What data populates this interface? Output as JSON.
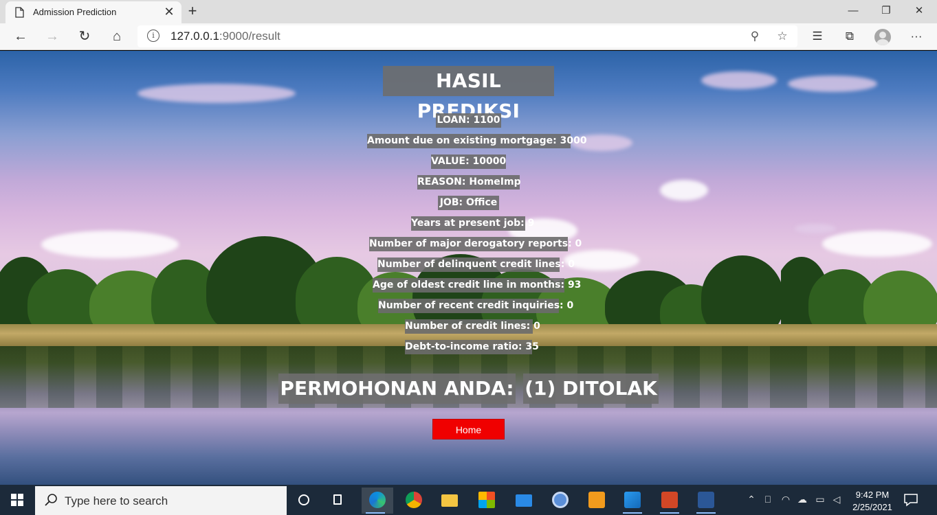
{
  "browser": {
    "tab_title": "Admission Prediction",
    "url_host": "127.0.0.1",
    "url_path": ":9000/result"
  },
  "result": {
    "heading": "HASIL PREDIKSI",
    "fields": [
      "LOAN: 1100",
      "Amount due on existing mortgage: 3000",
      "VALUE: 10000",
      "REASON: HomeImp",
      "JOB: Office",
      "Years at present job: 9",
      "Number of major derogatory reports: 0",
      "Number of delinquent credit lines: 0",
      "Age of oldest credit line in months: 93",
      "Number of recent credit inquiries: 0",
      "Number of credit lines: 0",
      "Debt-to-income ratio: 35"
    ],
    "verdict_label": "PERMOHONAN ANDA:",
    "verdict_value": "(1) DITOLAK",
    "home_button": "Home"
  },
  "taskbar": {
    "search_placeholder": "Type here to search",
    "time": "9:42 PM",
    "date": "2/25/2021",
    "apps": [
      "cortana-icon",
      "task-view-icon",
      "edge-icon",
      "chrome-icon",
      "file-explorer-icon",
      "store-icon",
      "mail-icon",
      "chrome-alt-icon",
      "sublime-icon",
      "vscode-icon",
      "powerpoint-icon",
      "word-icon"
    ]
  },
  "colors": {
    "home_button": "#f00000",
    "label_bg": "#6c6c6c",
    "taskbar": "#1c2a3a"
  }
}
